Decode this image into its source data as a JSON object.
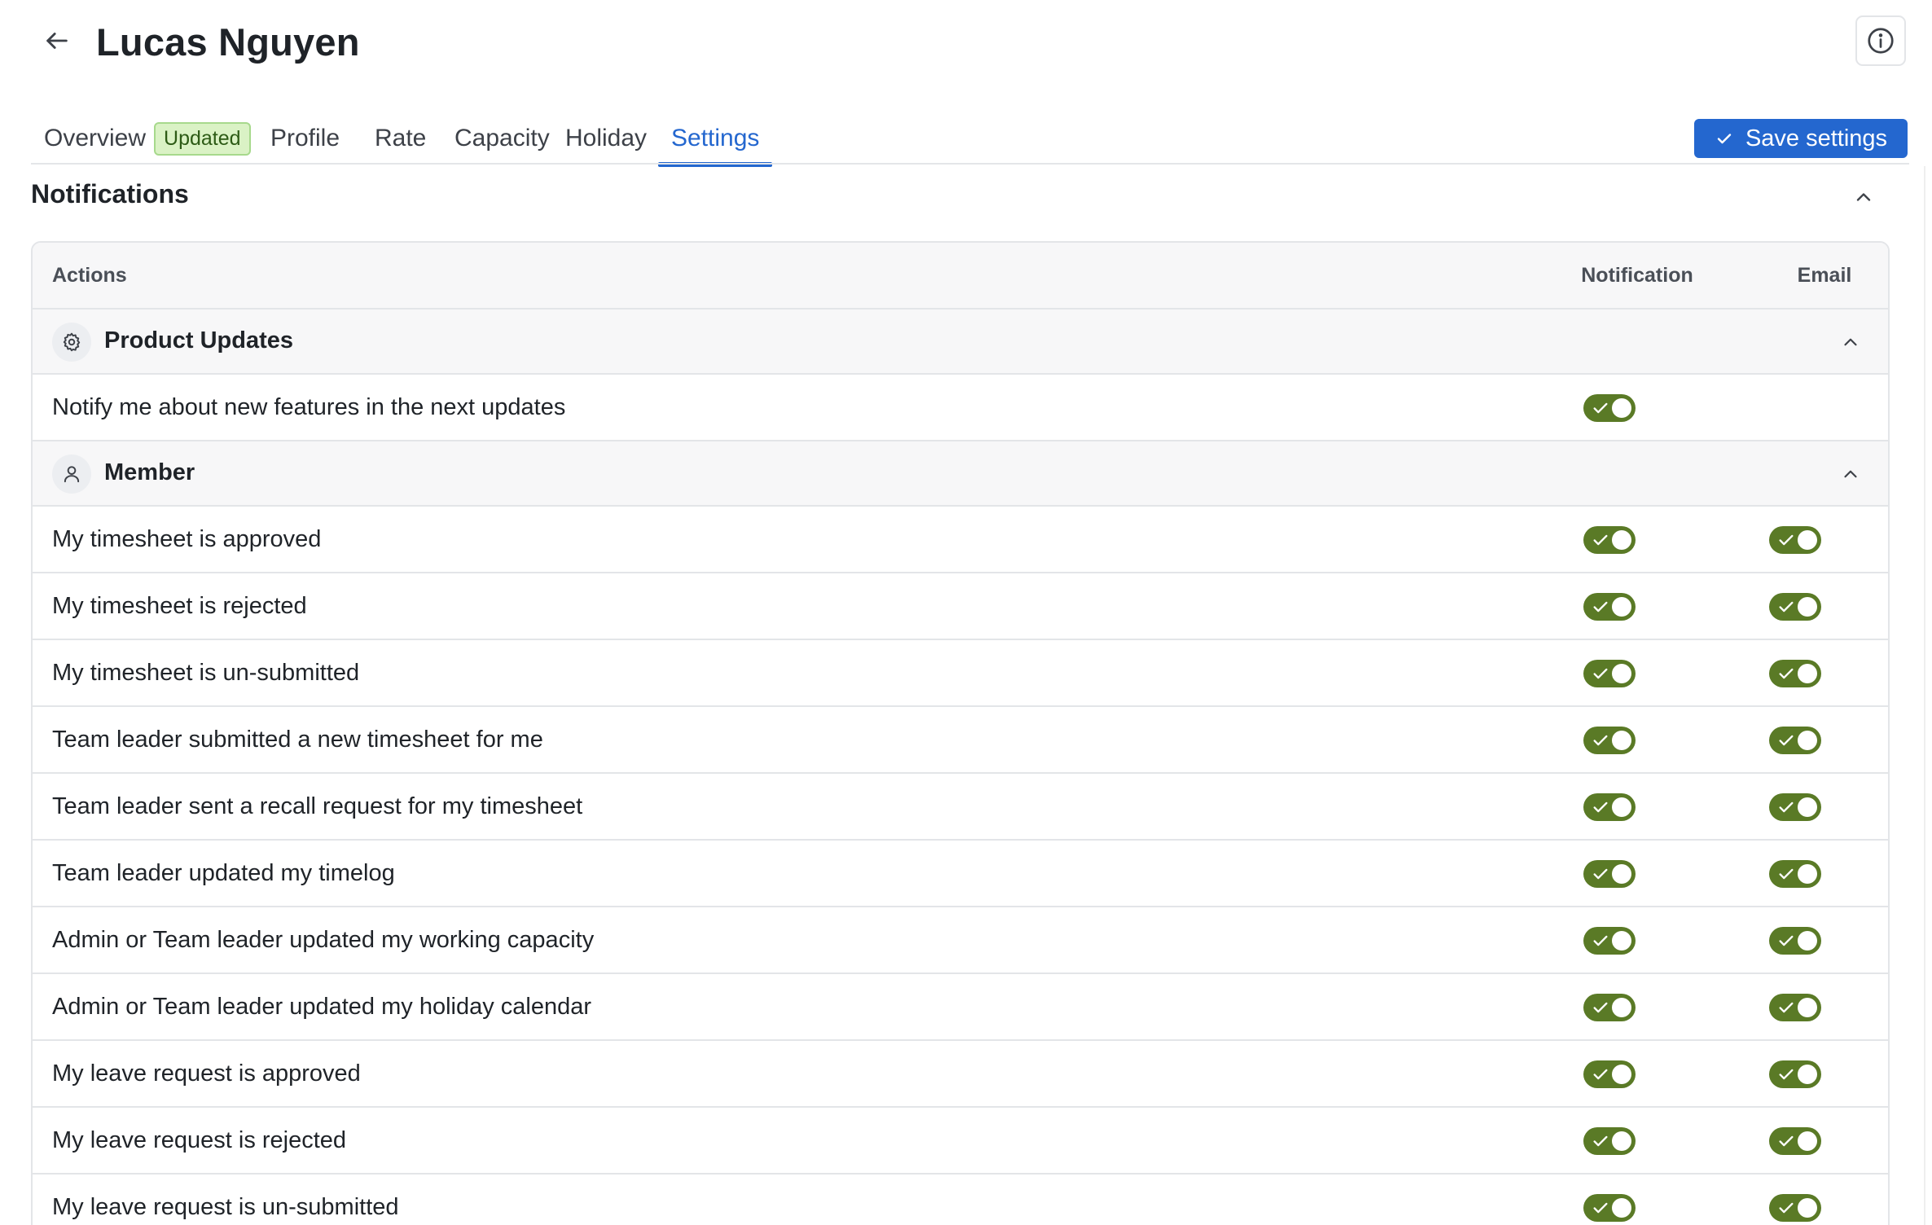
{
  "header": {
    "title": "Lucas Nguyen",
    "back_icon": "arrow-left-icon",
    "info_icon": "info-circle-icon"
  },
  "tabs": [
    {
      "label": "Overview",
      "badge": "Updated",
      "active": false
    },
    {
      "label": "Profile",
      "active": false
    },
    {
      "label": "Rate",
      "active": false
    },
    {
      "label": "Capacity",
      "active": false
    },
    {
      "label": "Holiday",
      "active": false
    },
    {
      "label": "Settings",
      "active": true
    }
  ],
  "toolbar": {
    "save_label": "Save settings",
    "save_icon": "check-icon"
  },
  "colors": {
    "accent": "#2467cf",
    "toggle_on": "#5a7a26",
    "badge_bg": "#daf2c5",
    "badge_border": "#a7d98c"
  },
  "notifications": {
    "title": "Notifications",
    "columns": {
      "actions": "Actions",
      "notification": "Notification",
      "email": "Email"
    },
    "groups": [
      {
        "label": "Product Updates",
        "icon": "gear-icon",
        "expanded": true,
        "rows": [
          {
            "label": "Notify me about new features in the next updates",
            "notification": true,
            "email": null
          }
        ]
      },
      {
        "label": "Member",
        "icon": "user-icon",
        "expanded": true,
        "rows": [
          {
            "label": "My timesheet is approved",
            "notification": true,
            "email": true
          },
          {
            "label": "My timesheet is rejected",
            "notification": true,
            "email": true
          },
          {
            "label": "My timesheet is un-submitted",
            "notification": true,
            "email": true
          },
          {
            "label": "Team leader submitted a new timesheet for me",
            "notification": true,
            "email": true
          },
          {
            "label": "Team leader sent a recall request for my timesheet",
            "notification": true,
            "email": true
          },
          {
            "label": "Team leader updated my timelog",
            "notification": true,
            "email": true
          },
          {
            "label": "Admin or Team leader updated my working capacity",
            "notification": true,
            "email": true
          },
          {
            "label": "Admin or Team leader updated my holiday calendar",
            "notification": true,
            "email": true
          },
          {
            "label": "My leave request is approved",
            "notification": true,
            "email": true
          },
          {
            "label": "My leave request is rejected",
            "notification": true,
            "email": true
          },
          {
            "label": "My leave request is un-submitted",
            "notification": true,
            "email": true
          }
        ]
      }
    ]
  }
}
